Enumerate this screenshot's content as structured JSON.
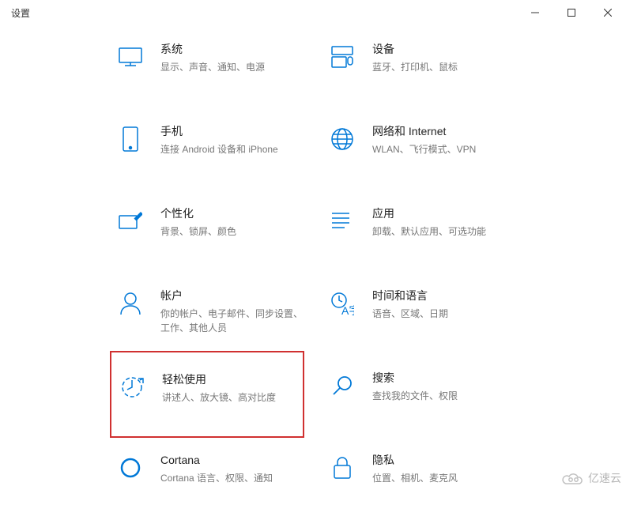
{
  "window": {
    "title": "设置"
  },
  "tiles": [
    {
      "title": "系统",
      "subtitle": "显示、声音、通知、电源"
    },
    {
      "title": "设备",
      "subtitle": "蓝牙、打印机、鼠标"
    },
    {
      "title": "手机",
      "subtitle": "连接 Android 设备和 iPhone"
    },
    {
      "title": "网络和 Internet",
      "subtitle": "WLAN、飞行模式、VPN"
    },
    {
      "title": "个性化",
      "subtitle": "背景、锁屏、颜色"
    },
    {
      "title": "应用",
      "subtitle": "卸载、默认应用、可选功能"
    },
    {
      "title": "帐户",
      "subtitle": "你的帐户、电子邮件、同步设置、工作、其他人员"
    },
    {
      "title": "时间和语言",
      "subtitle": "语音、区域、日期"
    },
    {
      "title": "轻松使用",
      "subtitle": "讲述人、放大镜、高对比度"
    },
    {
      "title": "搜索",
      "subtitle": "查找我的文件、权限"
    },
    {
      "title": "Cortana",
      "subtitle": "Cortana 语言、权限、通知"
    },
    {
      "title": "隐私",
      "subtitle": "位置、相机、麦克风"
    }
  ],
  "watermark": "亿速云"
}
